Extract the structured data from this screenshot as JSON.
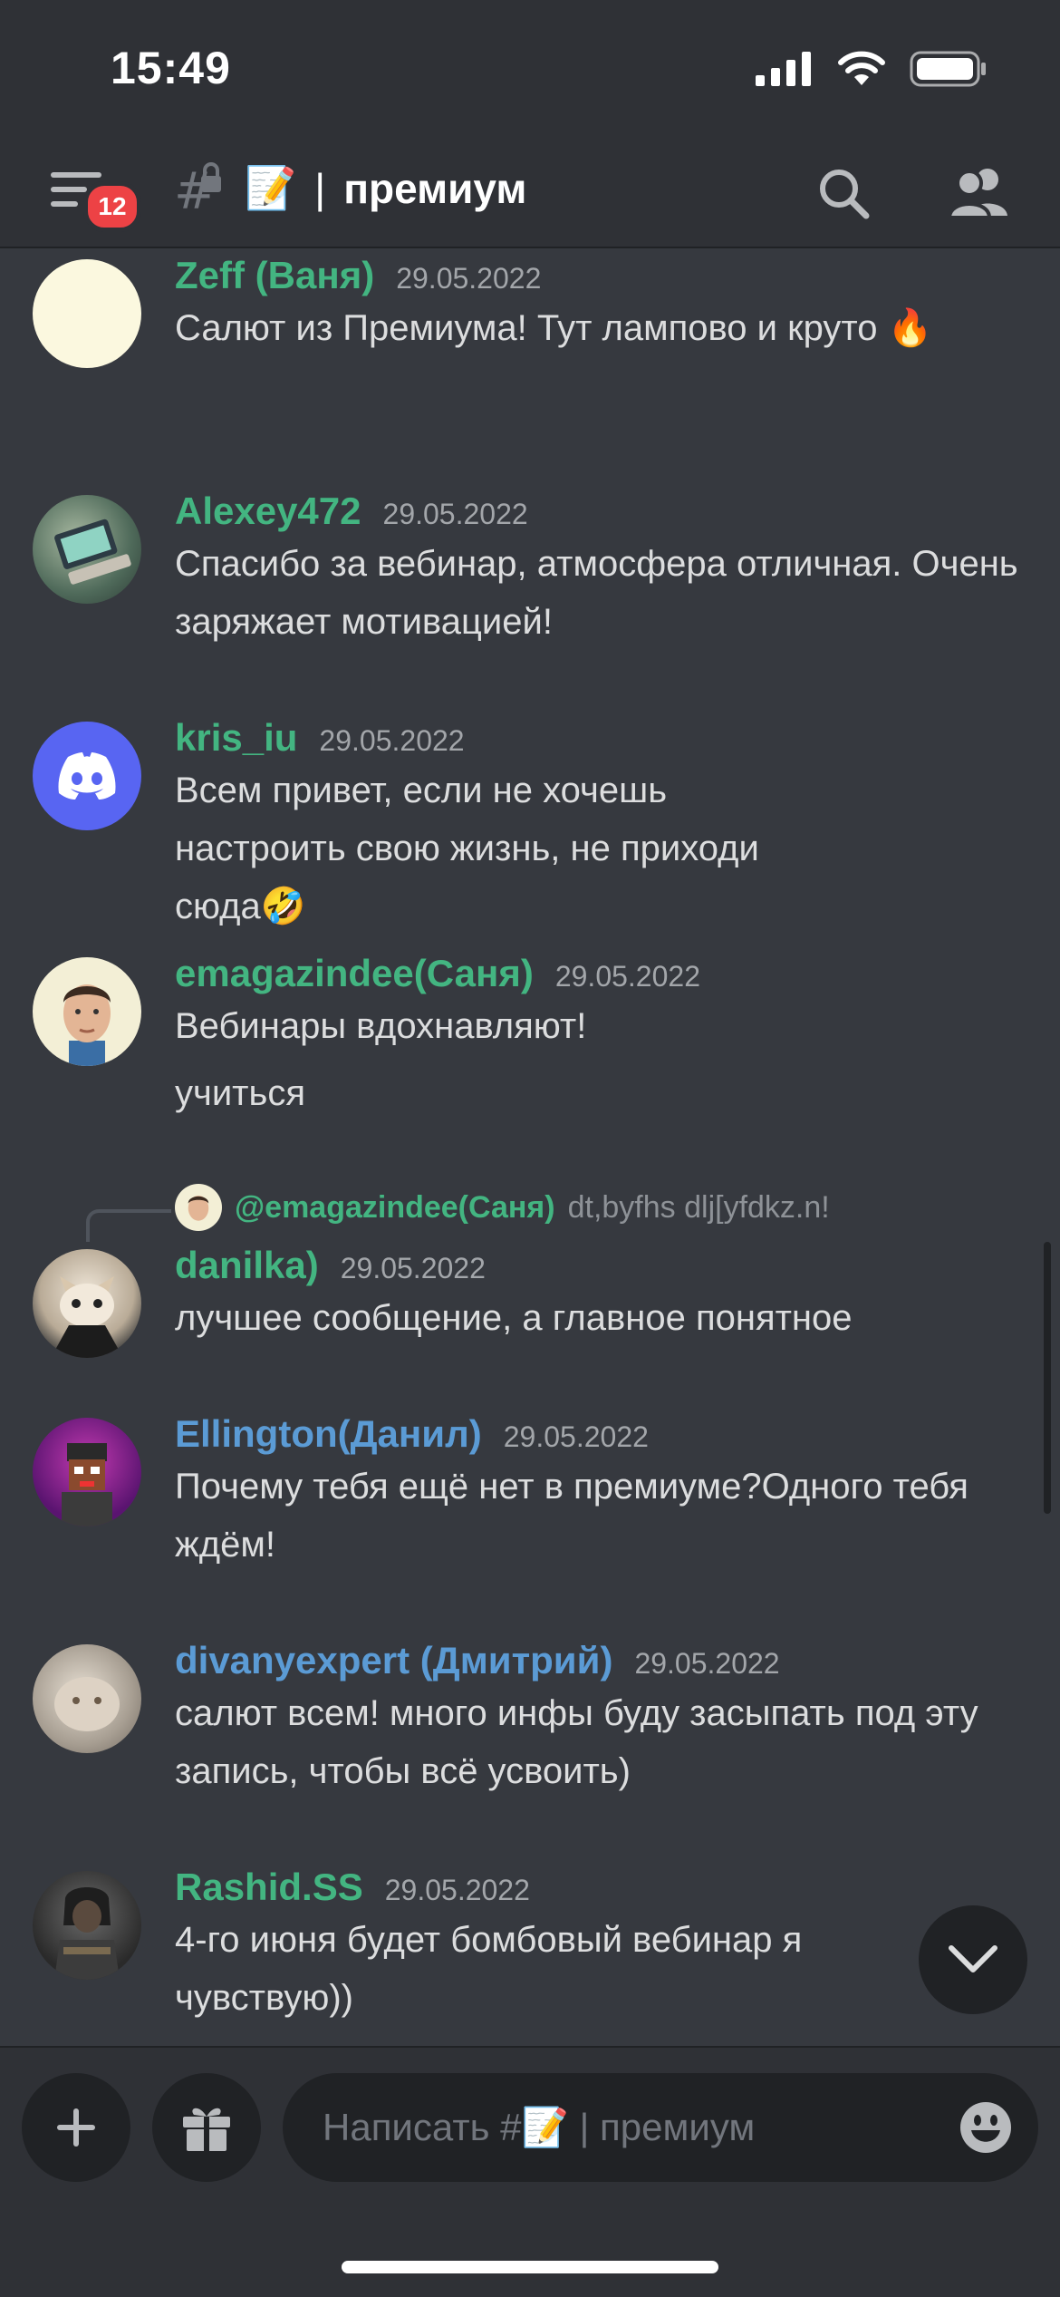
{
  "status": {
    "time": "15:49"
  },
  "header": {
    "badge_count": "12",
    "channel_emoji": "📝",
    "separator": "|",
    "channel_name": "премиум"
  },
  "messages": [
    {
      "author": "Zeff (Ваня)",
      "timestamp": "29.05.2022",
      "text": "Салют из Премиума! Тут лампово и круто 🔥",
      "name_color": "#43b581"
    },
    {
      "author": "Alexey472",
      "timestamp": "29.05.2022",
      "text": "Спасибо за вебинар, атмосфера отличная. Очень заряжает мотивацией!",
      "name_color": "#43b581"
    },
    {
      "author": "kris_iu",
      "timestamp": "29.05.2022",
      "text": "Всем привет, если не хочешь настроить свою жизнь, не приходи сюда🤣",
      "name_color": "#43b581"
    },
    {
      "author": "emagazindee(Саня)",
      "timestamp": "29.05.2022",
      "text": "Вебинары вдохнавляют!",
      "text2": "учиться",
      "name_color": "#43b581"
    },
    {
      "reply_to": "@emagazindee(Саня)",
      "reply_text": "dt,byfhs dlj[yfdkz.n!",
      "author": "danilka)",
      "timestamp": "29.05.2022",
      "text": "лучшее сообщение, а главное понятное",
      "name_color": "#43b581"
    },
    {
      "author": "Ellington(Данил)",
      "timestamp": "29.05.2022",
      "text": "Почему тебя ещё нет в премиуме?Одного тебя ждём!",
      "name_color": "#5b9bd5"
    },
    {
      "author": "divanyexpert (Дмитрий)",
      "timestamp": "29.05.2022",
      "text": "салют всем! много инфы буду засыпать под эту запись, чтобы всё усвоить)",
      "name_color": "#5b9bd5"
    },
    {
      "author": "Rashid.SS",
      "timestamp": "29.05.2022",
      "text": "4-го июня будет бомбовый вебинар я чувствую))",
      "name_color": "#43b581"
    }
  ],
  "composer": {
    "placeholder": "Написать #📝 | премиум"
  }
}
